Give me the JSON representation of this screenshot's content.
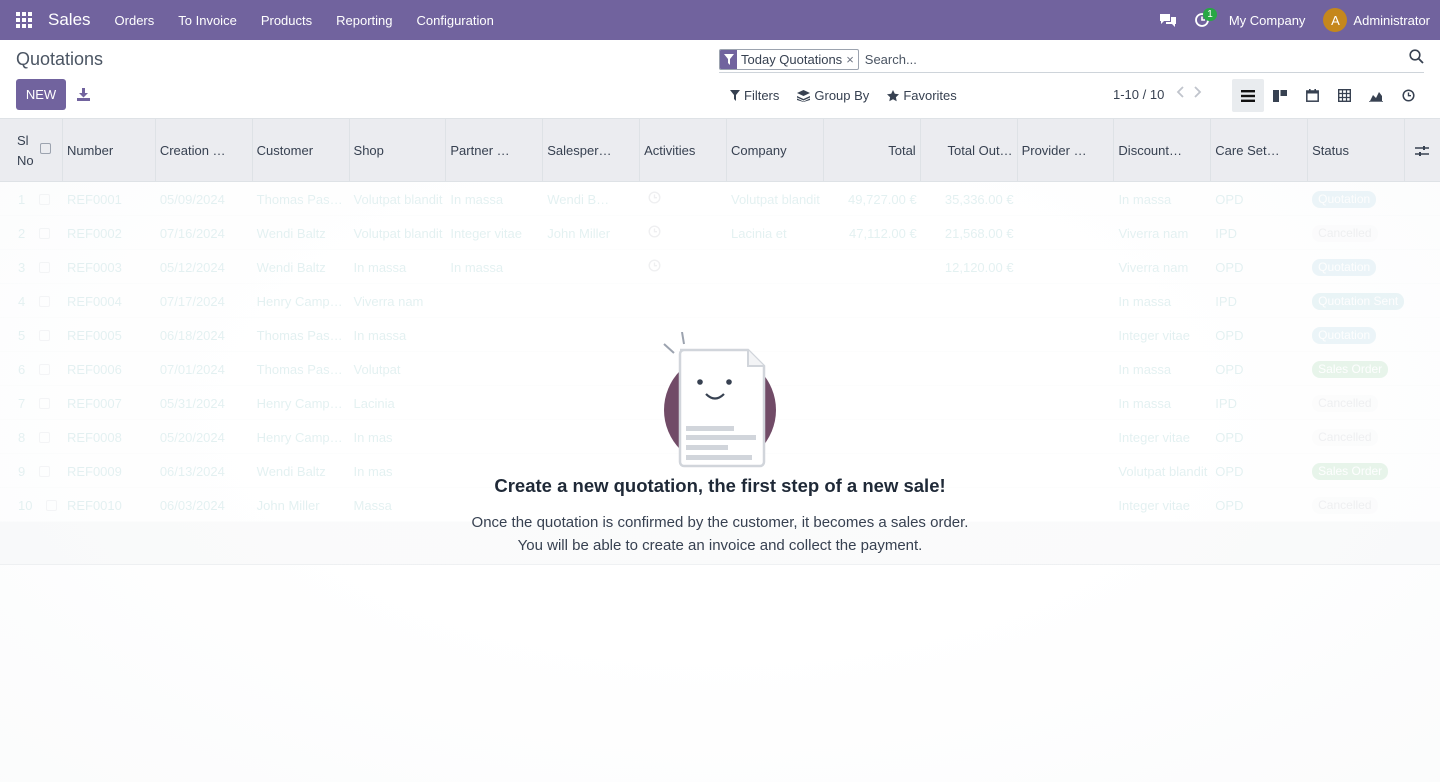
{
  "navbar": {
    "app_name": "Sales",
    "menu": [
      "Orders",
      "To Invoice",
      "Products",
      "Reporting",
      "Configuration"
    ],
    "activity_count": "1",
    "company": "My Company",
    "user_initial": "A",
    "user_name": "Administrator",
    "color": "#71639e"
  },
  "control": {
    "title": "Quotations",
    "new_label": "NEW",
    "facet_value": "Today Quotations",
    "facet_remove": "×",
    "search_placeholder": "Search...",
    "filters_label": "Filters",
    "groupby_label": "Group By",
    "favorites_label": "Favorites",
    "pager": "1-10 / 10",
    "views": [
      "list-view-icon",
      "kanban-view-icon",
      "calendar-view-icon",
      "pivot-view-icon",
      "graph-view-icon",
      "activity-view-icon"
    ]
  },
  "table": {
    "headers": [
      "Sl No",
      "Number",
      "Creation …",
      "Customer",
      "Shop",
      "Partner …",
      "Salesper…",
      "Activities",
      "Company",
      "Total",
      "Total Out…",
      "Provider …",
      "Discount…",
      "Care Set…",
      "Status"
    ],
    "rows": [
      {
        "sl": "1",
        "number": "REF0001",
        "date": "05/09/2024",
        "customer": "Thomas Pas…",
        "shop": "Volutpat blandit",
        "partner": "In massa",
        "salesperson": "Wendi B…",
        "company": "Volutpat blandit",
        "total": "49,727.00 €",
        "outstanding": "35,336.00 €",
        "discount": "In massa",
        "care": "OPD",
        "status": "Quotation",
        "status_type": "quote"
      },
      {
        "sl": "2",
        "number": "REF0002",
        "date": "07/16/2024",
        "customer": "Wendi Baltz",
        "shop": "Volutpat blandit",
        "partner": "Integer vitae",
        "salesperson": "John Miller",
        "company": "Lacinia et",
        "total": "47,112.00 €",
        "outstanding": "21,568.00 €",
        "discount": "Viverra nam",
        "care": "IPD",
        "status": "Cancelled",
        "status_type": "cancel"
      },
      {
        "sl": "3",
        "number": "REF0003",
        "date": "05/12/2024",
        "customer": "Wendi Baltz",
        "shop": "In massa",
        "partner": "In massa",
        "salesperson": "",
        "company": "",
        "total": "",
        "outstanding": "12,120.00 €",
        "discount": "Viverra nam",
        "care": "OPD",
        "status": "Quotation",
        "status_type": "quote"
      },
      {
        "sl": "4",
        "number": "REF0004",
        "date": "07/17/2024",
        "customer": "Henry Camp…",
        "shop": "Viverra nam",
        "partner": "",
        "salesperson": "",
        "company": "",
        "total": "",
        "outstanding": "",
        "discount": "In massa",
        "care": "IPD",
        "status": "Quotation Sent",
        "status_type": "sent"
      },
      {
        "sl": "5",
        "number": "REF0005",
        "date": "06/18/2024",
        "customer": "Thomas Pas…",
        "shop": "In massa",
        "partner": "",
        "salesperson": "",
        "company": "",
        "total": "",
        "outstanding": "",
        "discount": "Integer vitae",
        "care": "OPD",
        "status": "Quotation",
        "status_type": "quote"
      },
      {
        "sl": "6",
        "number": "REF0006",
        "date": "07/01/2024",
        "customer": "Thomas Pas…",
        "shop": "Volutpat",
        "partner": "",
        "salesperson": "",
        "company": "",
        "total": "",
        "outstanding": "",
        "discount": "In massa",
        "care": "OPD",
        "status": "Sales Order",
        "status_type": "sale"
      },
      {
        "sl": "7",
        "number": "REF0007",
        "date": "05/31/2024",
        "customer": "Henry Camp…",
        "shop": "Lacinia",
        "partner": "",
        "salesperson": "",
        "company": "",
        "total": "",
        "outstanding": "",
        "discount": "In massa",
        "care": "IPD",
        "status": "Cancelled",
        "status_type": "cancel"
      },
      {
        "sl": "8",
        "number": "REF0008",
        "date": "05/20/2024",
        "customer": "Henry Camp…",
        "shop": "In mas",
        "partner": "",
        "salesperson": "",
        "company": "",
        "total": "",
        "outstanding": "",
        "discount": "Integer vitae",
        "care": "OPD",
        "status": "Cancelled",
        "status_type": "cancel"
      },
      {
        "sl": "9",
        "number": "REF0009",
        "date": "06/13/2024",
        "customer": "Wendi Baltz",
        "shop": "In mas",
        "partner": "",
        "salesperson": "",
        "company": "",
        "total": "",
        "outstanding": "",
        "discount": "Volutpat blandit",
        "care": "OPD",
        "status": "Sales Order",
        "status_type": "sale"
      },
      {
        "sl": "10",
        "number": "REF0010",
        "date": "06/03/2024",
        "customer": "John Miller",
        "shop": "Massa",
        "partner": "",
        "salesperson": "",
        "company": "",
        "total": "",
        "outstanding": "",
        "discount": "Integer vitae",
        "care": "OPD",
        "status": "Cancelled",
        "status_type": "cancel"
      }
    ]
  },
  "helper": {
    "title": "Create a new quotation, the first step of a new sale!",
    "line1": "Once the quotation is confirmed by the customer, it becomes a sales order.",
    "line2": "You will be able to create an invoice and collect the payment."
  }
}
